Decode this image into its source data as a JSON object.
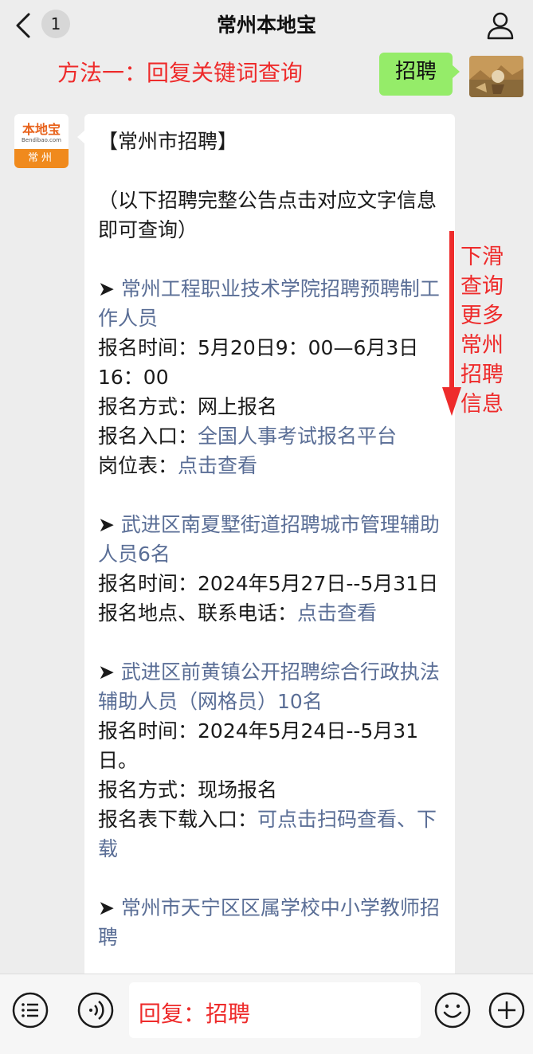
{
  "header": {
    "title": "常州本地宝",
    "unread_count": "1",
    "back_icon": "chevron-left-icon",
    "profile_icon": "person-icon"
  },
  "annotation_method": "方法一：回复关键词查询",
  "sent_message": "招聘",
  "bot": {
    "logo_text": "本地宝",
    "logo_sub": "Bendibao.com",
    "city_label": "常州"
  },
  "reply": {
    "heading": "【常州市招聘】",
    "note": "（以下招聘完整公告点击对应文字信息即可查询）",
    "jobs": [
      {
        "title": "常州工程职业技术学院招聘预聘制工作人员",
        "lines": [
          {
            "label": "报名时间：",
            "value": "5月20日9：00—6月3日16：00",
            "link": ""
          },
          {
            "label": "报名方式：",
            "value": "网上报名",
            "link": ""
          },
          {
            "label": "报名入口：",
            "value": "",
            "link": "全国人事考试报名平台"
          },
          {
            "label": "岗位表：",
            "value": "",
            "link": "点击查看"
          }
        ]
      },
      {
        "title": "武进区南夏墅街道招聘城市管理辅助人员6名",
        "lines": [
          {
            "label": "报名时间：",
            "value": "2024年5月27日--5月31日",
            "link": ""
          },
          {
            "label": "报名地点、联系电话：",
            "value": "",
            "link": "点击查看"
          }
        ]
      },
      {
        "title": "武进区前黄镇公开招聘综合行政执法辅助人员（网格员）10名",
        "lines": [
          {
            "label": "报名时间：",
            "value": "2024年5月24日--5月31日。",
            "link": ""
          },
          {
            "label": "报名方式：",
            "value": "现场报名",
            "link": ""
          },
          {
            "label": "报名表下载入口：",
            "value": "",
            "link": "可点击扫码查看、下载"
          }
        ]
      },
      {
        "title": "常州市天宁区区属学校中小学教师招聘",
        "lines": []
      }
    ]
  },
  "scroll_hint": [
    "下滑",
    "查询",
    "更多",
    "常州",
    "招聘",
    "信息"
  ],
  "input": {
    "text": "回复：招聘",
    "menu_icon": "menu-icon",
    "voice_icon": "voice-icon",
    "emoji_icon": "emoji-icon",
    "add_icon": "plus-icon"
  },
  "colors": {
    "accent_red": "#ee2b2b",
    "link": "#5a6e96",
    "sent_bubble": "#95ec69",
    "brand_orange": "#f08a1d"
  }
}
